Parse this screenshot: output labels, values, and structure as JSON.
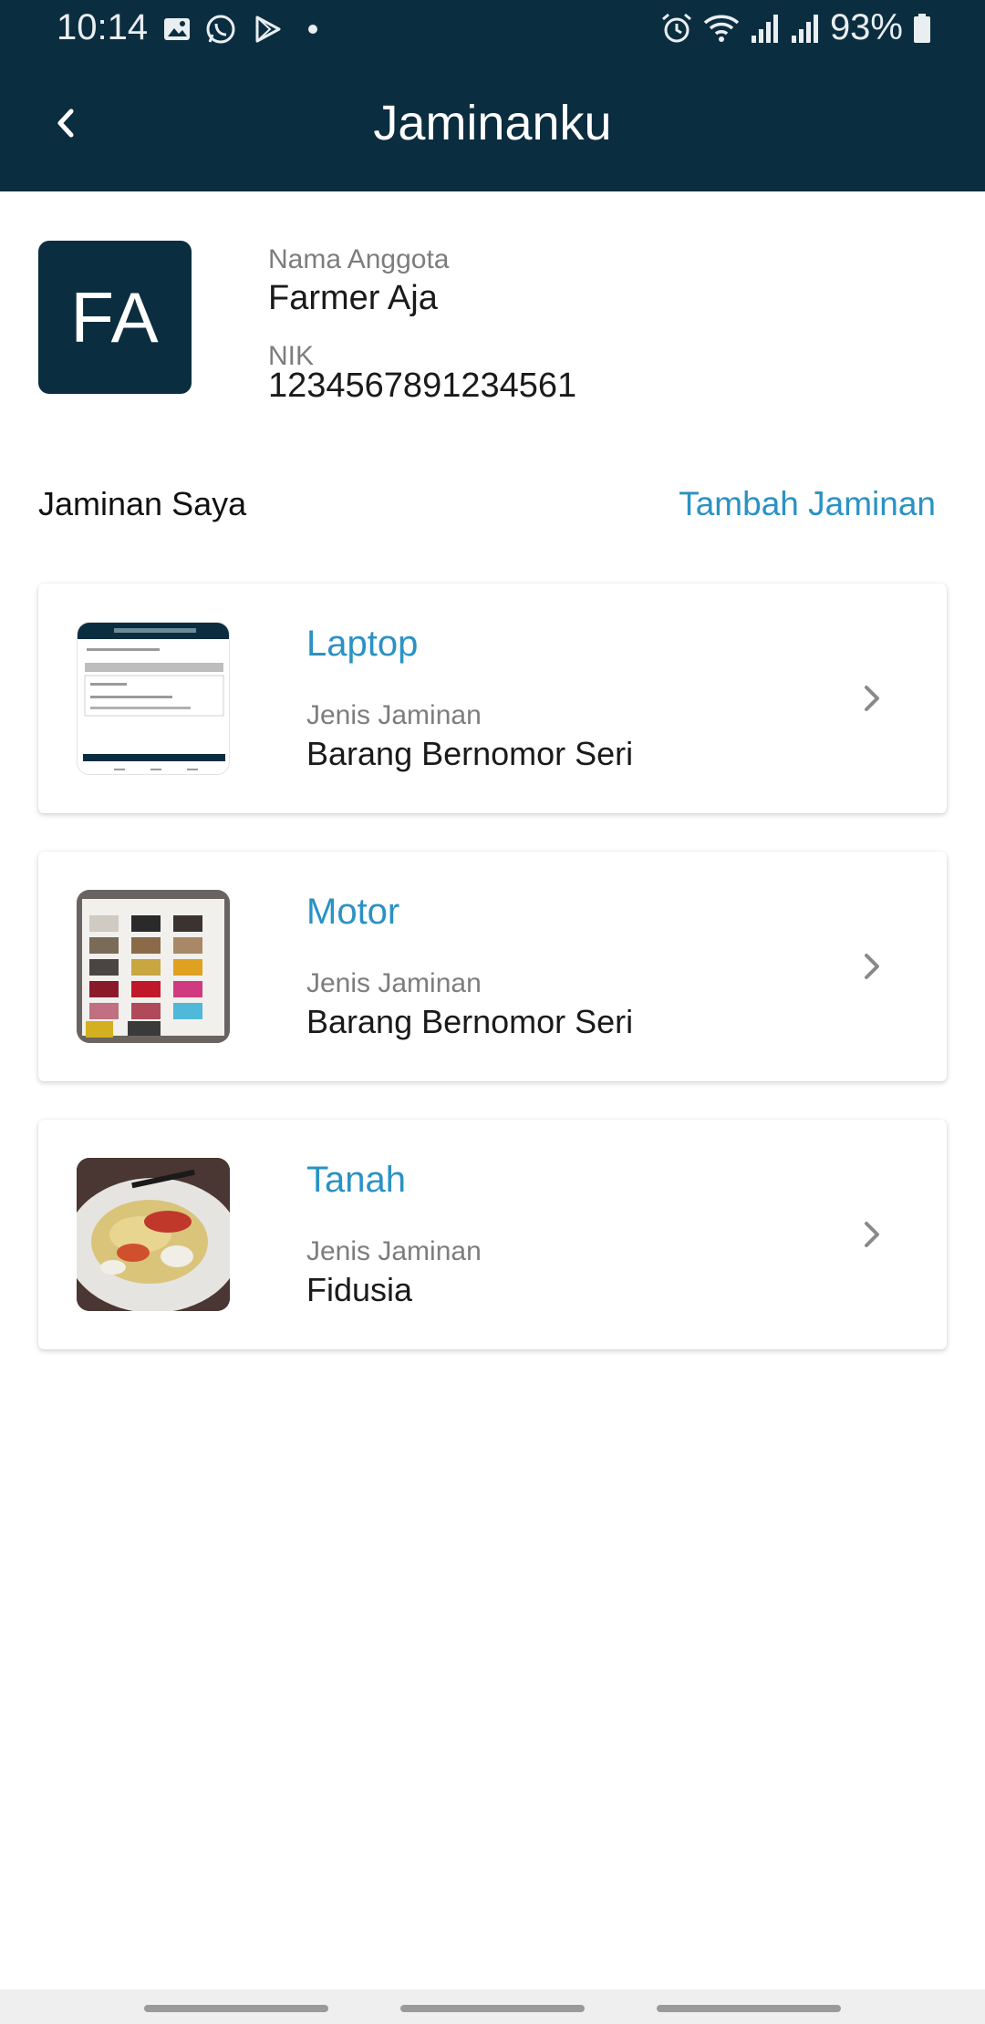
{
  "status_bar": {
    "time": "10:14",
    "battery": "93%",
    "icons": [
      "gallery-icon",
      "whatsapp-icon",
      "play-store-icon",
      "dot-icon",
      "alarm-icon",
      "wifi-icon",
      "signal-icon",
      "signal-icon",
      "battery-icon"
    ]
  },
  "app_bar": {
    "title": "Jaminanku",
    "back_icon": "chevron-left-icon"
  },
  "profile": {
    "avatar_initials": "FA",
    "name_label": "Nama Anggota",
    "name": "Farmer Aja",
    "nik_label": "NIK",
    "nik": "1234567891234561"
  },
  "section": {
    "title": "Jaminan Saya",
    "action": "Tambah Jaminan"
  },
  "collaterals": [
    {
      "name": "Laptop",
      "type_label": "Jenis Jaminan",
      "type": "Barang Bernomor Seri",
      "thumbnail": "screenshot-thumbnail"
    },
    {
      "name": "Motor",
      "type_label": "Jenis Jaminan",
      "type": "Barang Bernomor Seri",
      "thumbnail": "color-swatch-photo"
    },
    {
      "name": "Tanah",
      "type_label": "Jenis Jaminan",
      "type": "Fidusia",
      "thumbnail": "food-photo"
    }
  ],
  "colors": {
    "primary_dark": "#0b2d40",
    "accent": "#2a92c4",
    "label_gray": "#7d7d7d",
    "text": "#1a1a1a"
  }
}
